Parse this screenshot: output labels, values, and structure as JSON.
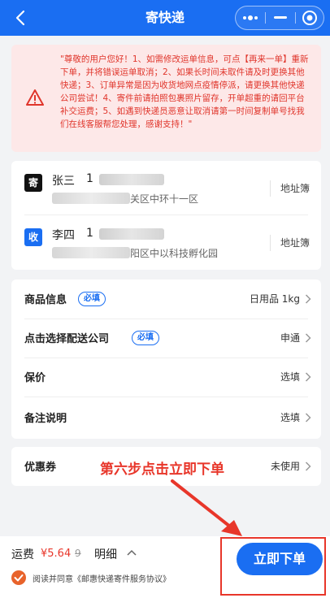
{
  "nav": {
    "title": "寄快递"
  },
  "notice": {
    "text": "\"尊敬的用户您好！1、如需修改运单信息，可点【再来一单】重新下单，并将错误运单取消；2、如果长时间未取件请及时更换其他快递；3、订单异常是因为收货地网点疫情停派，请更换其他快递公司尝试！4、寄件前请拍照包裹照片留存，开单超重的请回平台补交运费；5、如遇到快递员恶意让取消请第一时间复制单号找我们在线客服帮您处理，感谢支持！\""
  },
  "sender": {
    "tag": "寄",
    "name": "张三",
    "phone_prefix": "1",
    "address_tail": "关区中环十一区",
    "book_label": "地址簿"
  },
  "receiver": {
    "tag": "收",
    "name": "李四",
    "phone_prefix": "1",
    "address_tail": "阳区中以科技孵化园",
    "book_label": "地址簿"
  },
  "form": {
    "goods": {
      "label": "商品信息",
      "badge": "必填",
      "value": "日用品 1kg"
    },
    "courier": {
      "label": "点击选择配送公司",
      "badge": "必填",
      "value": "申通"
    },
    "insurance": {
      "label": "保价",
      "value": "选填"
    },
    "remark": {
      "label": "备注说明",
      "value": "选填"
    }
  },
  "coupon": {
    "label": "优惠券",
    "value": "未使用"
  },
  "annotation": {
    "text": "第六步点击立即下单"
  },
  "footer": {
    "fee_label": "运费",
    "price": "¥5.64",
    "original": "9",
    "detail_label": "明细",
    "agree_text": "阅读并同意《邮惠快递寄件服务协议》",
    "submit_label": "立即下单"
  },
  "colors": {
    "brand": "#1a6ef2",
    "accent_red": "#e8362a",
    "agree_orange": "#e8632b"
  }
}
